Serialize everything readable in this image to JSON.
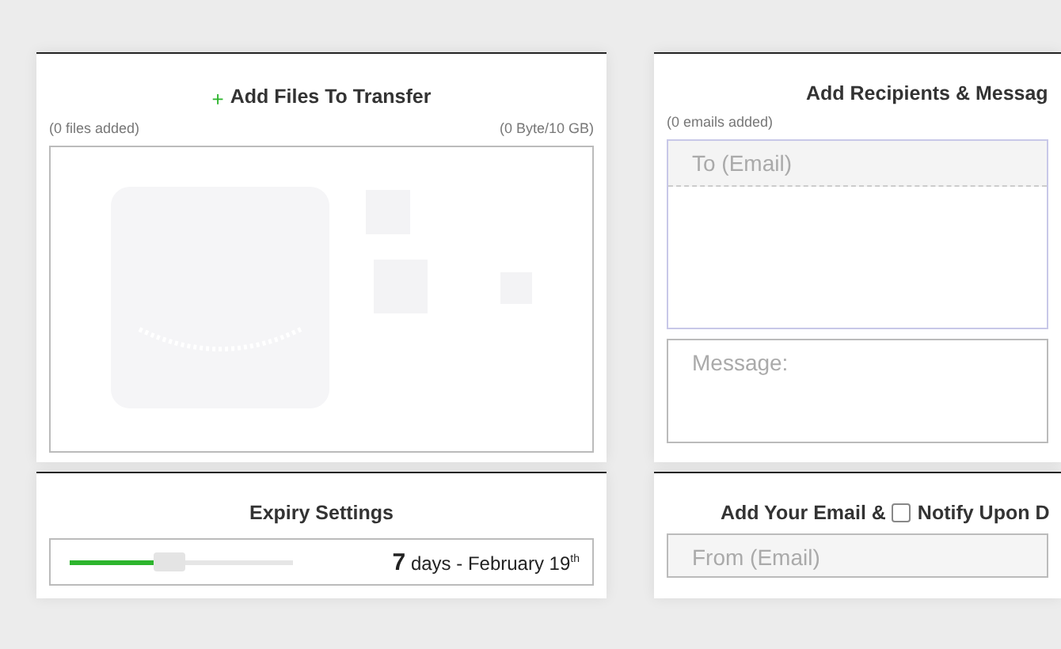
{
  "files_panel": {
    "icon": "+",
    "title": "Add Files To Transfer",
    "file_count": "(0 files added)",
    "size": "(0 Byte/10 GB)"
  },
  "expiry_panel": {
    "title": "Expiry Settings",
    "slider": {
      "level": 0.45
    },
    "reading": "**7** days - February 19$^{th}$"
  },
  "recipients_panel": {
    "title": "Add Recipients & Messag",
    "email_count": "(0 emails added)",
    "to_field": {
      "placeholder": "To (Email)"
    },
    "message_field": {
      "placeholder": "Message:"
    }
  },
  "sender_panel": {
    "title": "Add Your Email &",
    "notify": {
      "label": "Notify Upon D",
      "checked": false
    },
    "from_field": {
      "placeholder": "From (Email)"
    }
  }
}
